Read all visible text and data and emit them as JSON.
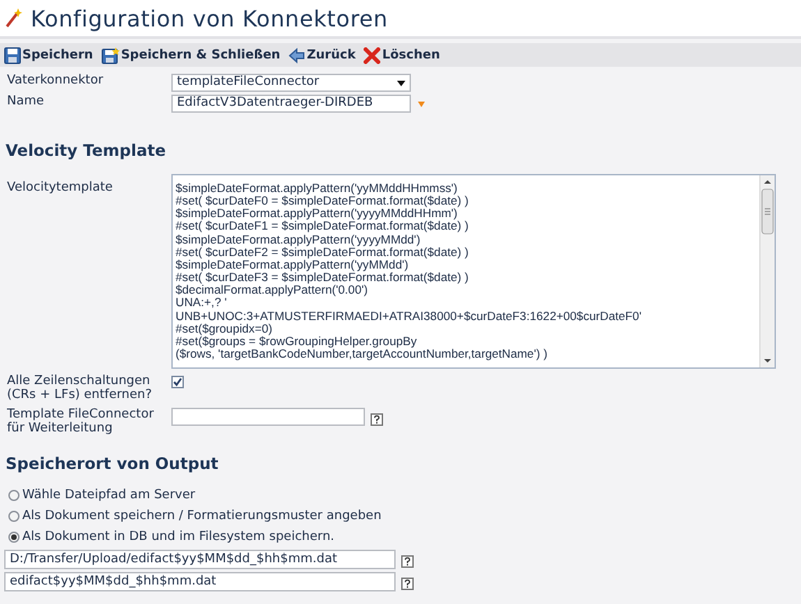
{
  "window": {
    "title": "Konfiguration von Konnektoren"
  },
  "toolbar": [
    {
      "kind": "save",
      "label": "Speichern"
    },
    {
      "kind": "save-close",
      "label": "Speichern & Schließen"
    },
    {
      "kind": "back",
      "label": "Zurück"
    },
    {
      "kind": "delete",
      "label": "Löschen"
    }
  ],
  "parent_connector": {
    "label": "Vaterkonnektor",
    "value": "templateFileConnector"
  },
  "name": {
    "label": "Name",
    "value": "EdifactV3Datentraeger-DIRDEB",
    "required": true
  },
  "velocity_section": {
    "heading": "Velocity Template",
    "label": "Velocitytemplate",
    "value": "$simpleDateFormat.applyPattern('yyMMddHHmmss')\n#set( $curDateF0 = $simpleDateFormat.format($date) )\n$simpleDateFormat.applyPattern('yyyyMMddHHmm')\n#set( $curDateF1 = $simpleDateFormat.format($date) )\n$simpleDateFormat.applyPattern('yyyyMMdd')\n#set( $curDateF2 = $simpleDateFormat.format($date) )\n$simpleDateFormat.applyPattern('yyMMdd')\n#set( $curDateF3 = $simpleDateFormat.format($date) )\n$decimalFormat.applyPattern('0.00')\nUNA:+,? '\nUNB+UNOC:3+ATMUSTERFIRMAEDI+ATRAI38000+$curDateF3:1622+00$curDateF0'\n#set($groupidx=0)\n#set($groups = $rowGroupingHelper.groupBy\n($rows, 'targetBankCodeNumber,targetAccountNumber,targetName') )"
  },
  "remove_linebreaks": {
    "label": "Alle Zeilenschaltungen (CRs + LFs) entfernen?",
    "checked": true
  },
  "forward_connector": {
    "label": "Template FileConnector für Weiterleitung"
  },
  "output_section": {
    "heading": "Speicherort von Output",
    "options": [
      {
        "label": "Wähle Dateipfad am Server",
        "selected": false
      },
      {
        "label": "Als Dokument speichern / Formatierungsmuster angeben",
        "selected": false
      },
      {
        "label": "Als Dokument in DB und im Filesystem speichern.",
        "selected": true
      }
    ],
    "path_fields": [
      {
        "value": "D:/Transfer/Upload/edifact$yy$MM$dd_$hh$mm.dat"
      },
      {
        "value": "edifact$yy$MM$dd_$hh$mm.dat"
      }
    ]
  }
}
